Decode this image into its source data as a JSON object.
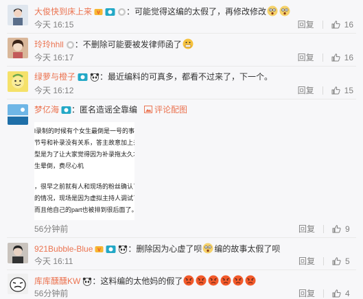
{
  "comments": [
    {
      "username": "大俊快到床上来",
      "content": "：可能觉得这编的太假了，再修改修改",
      "time": "今天 16:15",
      "reply": "回复",
      "likes": "16"
    },
    {
      "username": "玲玲hhll",
      "content": "：不删除可能要被发律师函了",
      "time": "今天 16:17",
      "reply": "回复",
      "likes": "16"
    },
    {
      "username": "绿萝与橙子",
      "content": "：最近编料的可真多，都看不过来了，下一个。",
      "time": "今天 16:12",
      "reply": "回复",
      "likes": "15"
    },
    {
      "username": "梦亿海",
      "content": "：匿名造谣全靠编",
      "pic_link": "评论配图",
      "doc_lines": [
        "l录制的时候有个女生最倒是一号的事情",
        "节号和补录没有关系，答主故意加上去，",
        "型是为了让大家觉得因为补录拖太久才逃",
        "生晕倒，费尽心机",
        "，很早之前就有人和现场的粉丝确认了",
        "的情况，现场是因为虚拟主持人调试了很",
        "而且他自己的part也被排到很后面了。"
      ],
      "time": "56分钟前",
      "reply": "回复",
      "likes": "9"
    },
    {
      "username": "921Bubble-Blue",
      "content_a": "：删除因为心虚了呗",
      "content_b": "编的故事太假了呗",
      "time": "今天 16:11",
      "reply": "回复",
      "likes": "5"
    },
    {
      "username": "库库醺醺KW",
      "content": "：这料编的太他妈的假了",
      "time": "56分钟前",
      "reply": "回复",
      "likes": "4"
    }
  ],
  "colors": {
    "username": "#eb7350",
    "meta": "#808080",
    "background": "#f7f7f9"
  }
}
